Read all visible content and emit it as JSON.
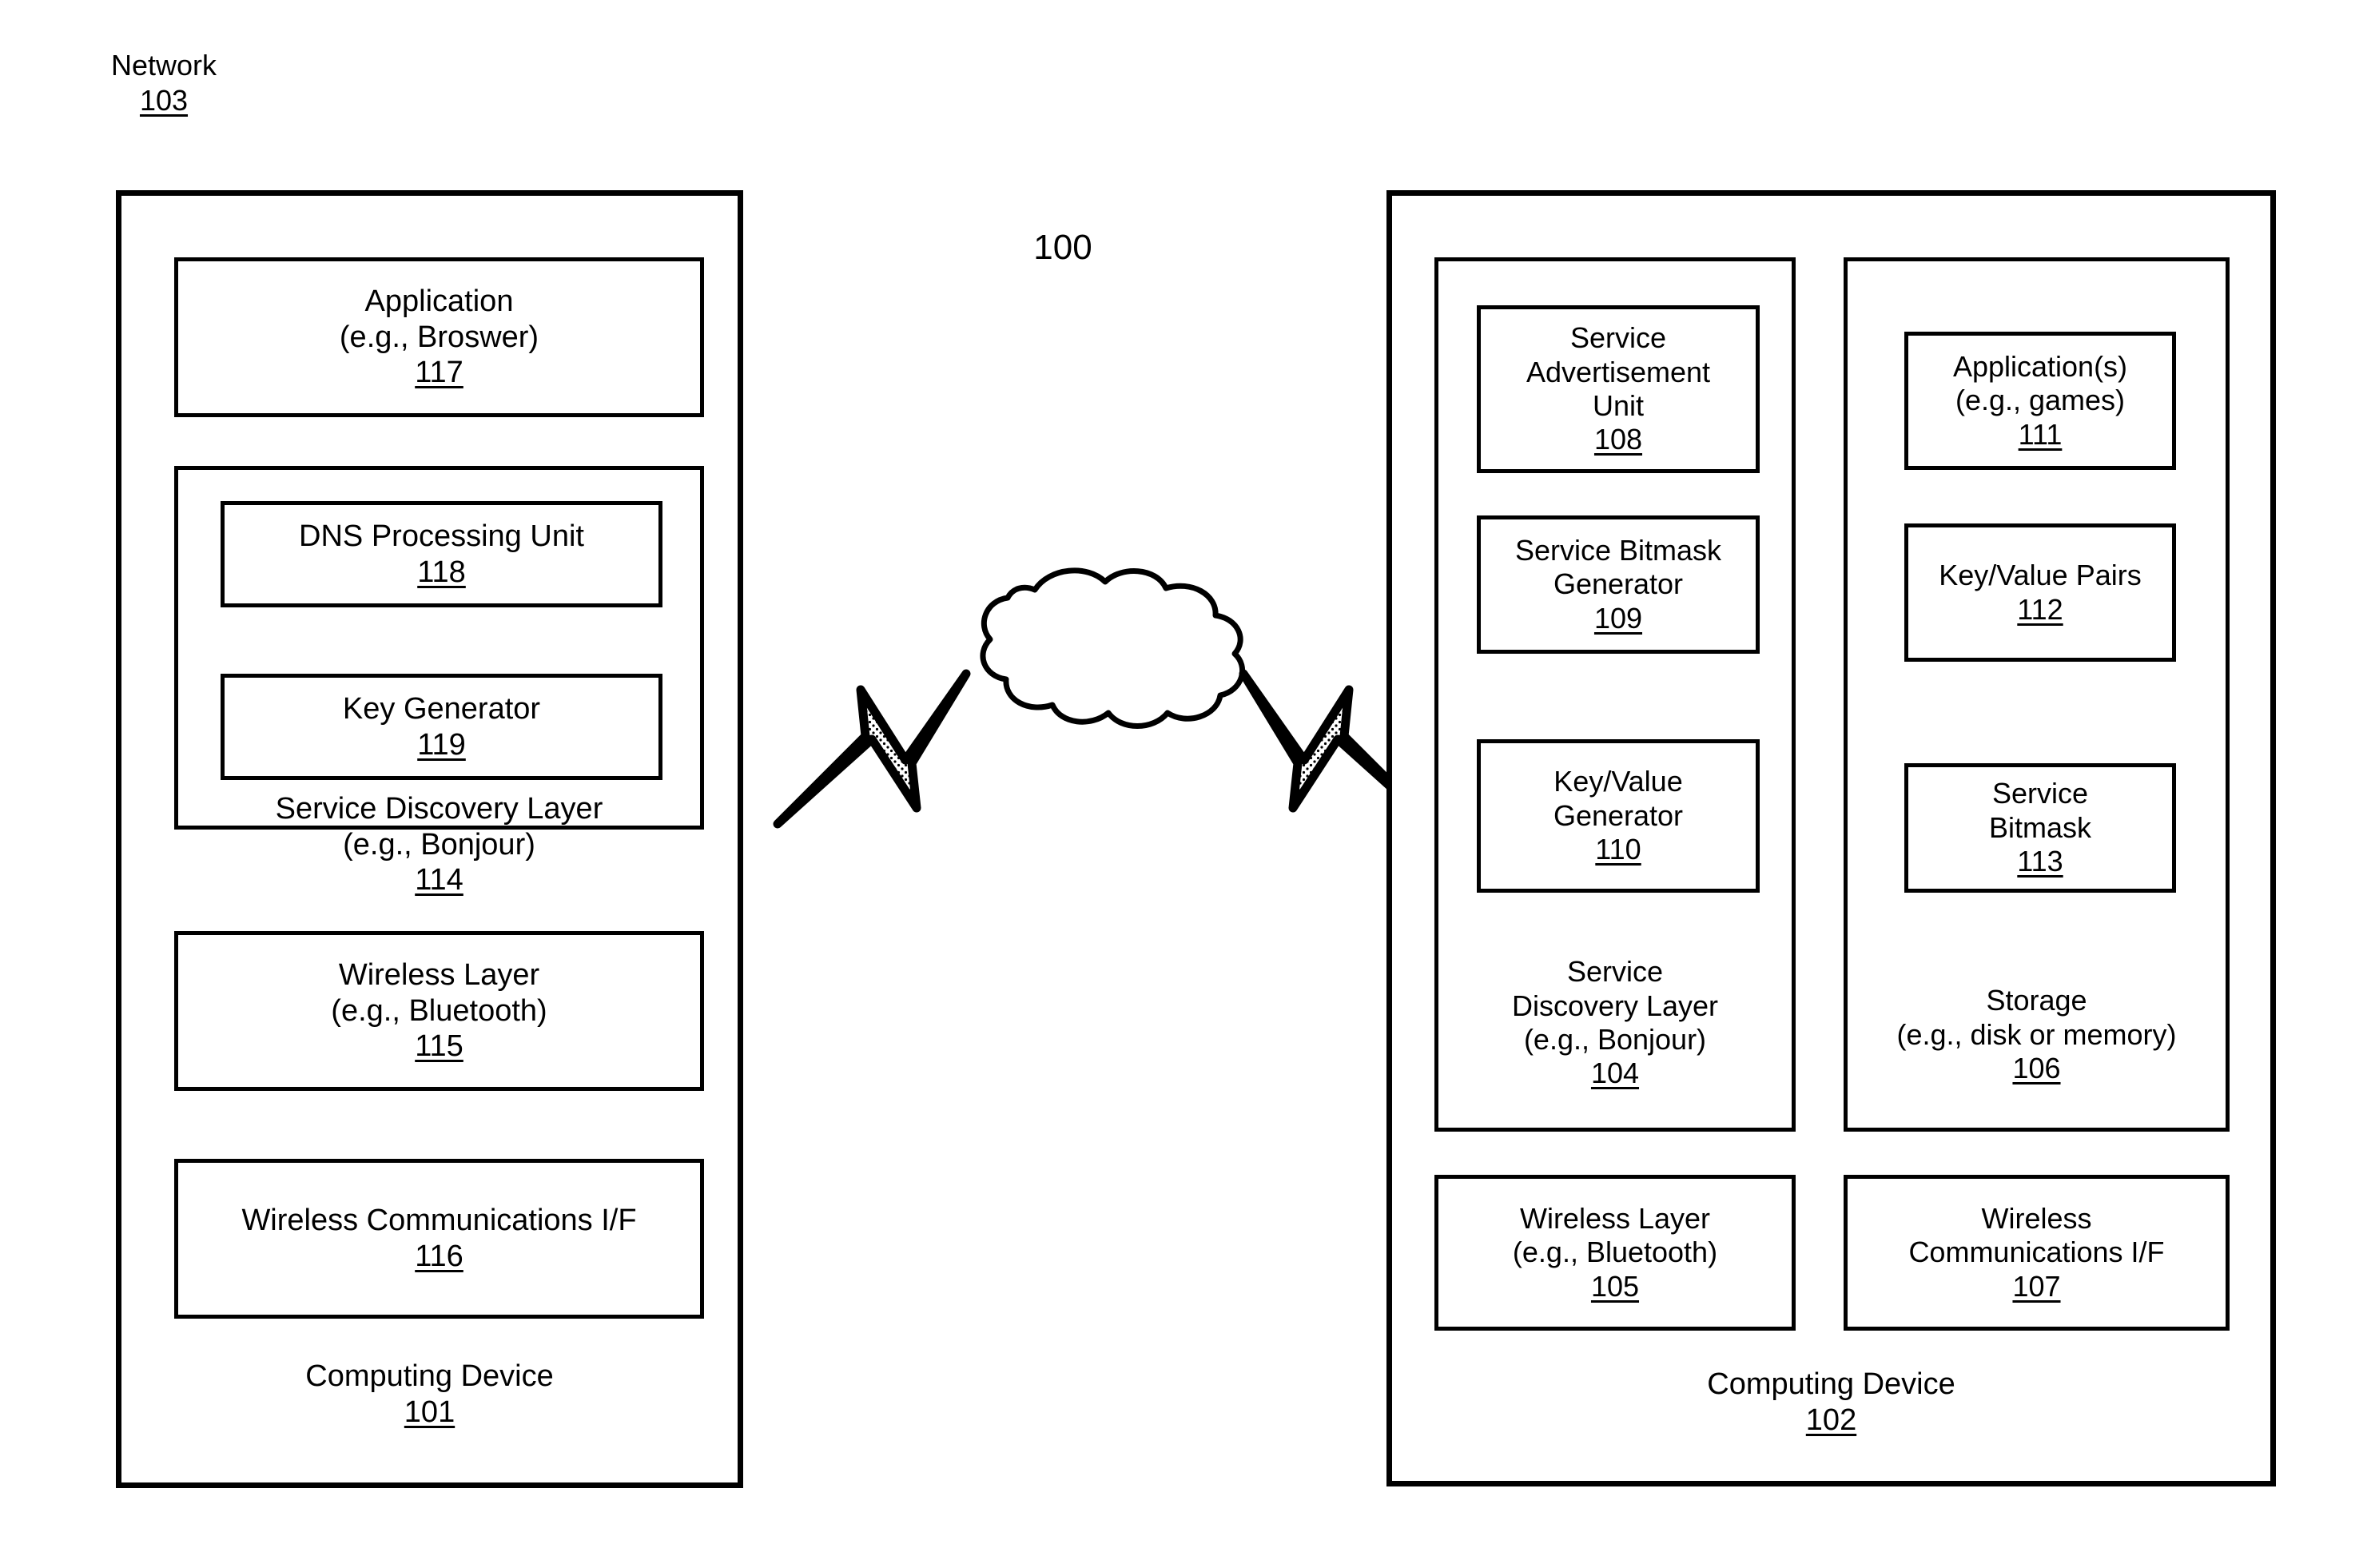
{
  "figure": {
    "number": "100"
  },
  "network": {
    "name": "Network",
    "ref": "103"
  },
  "left_device": {
    "title": "Computing Device",
    "ref": "101",
    "application": {
      "line1": "Application",
      "line2": "(e.g., Broswer)",
      "ref": "117"
    },
    "service_discovery_layer": {
      "line1": "Service Discovery Layer",
      "line2": "(e.g., Bonjour)",
      "ref": "114",
      "children": [
        {
          "line1": "DNS Processing Unit",
          "ref": "118"
        },
        {
          "line1": "Key Generator",
          "ref": "119"
        }
      ]
    },
    "wireless_layer": {
      "line1": "Wireless Layer",
      "line2": "(e.g., Bluetooth)",
      "ref": "115"
    },
    "wireless_comm_if": {
      "line1": "Wireless Communications I/F",
      "ref": "116"
    }
  },
  "right_device": {
    "title": "Computing Device",
    "ref": "102",
    "service_discovery_layer": {
      "line1": "Service",
      "line2": "Discovery Layer",
      "line3": "(e.g., Bonjour)",
      "ref": "104",
      "children": [
        {
          "line1": "Service",
          "line2": "Advertisement",
          "line3": "Unit",
          "ref": "108"
        },
        {
          "line1": "Service Bitmask",
          "line2": "Generator",
          "ref": "109"
        },
        {
          "line1": "Key/Value",
          "line2": "Generator",
          "ref": "110"
        }
      ]
    },
    "storage": {
      "line1": "Storage",
      "line2": "(e.g., disk or memory)",
      "ref": "106",
      "children": [
        {
          "line1": "Application(s)",
          "line2": "(e.g., games)",
          "ref": "111"
        },
        {
          "line1": "Key/Value Pairs",
          "ref": "112"
        },
        {
          "line1": "Service",
          "line2": "Bitmask",
          "ref": "113"
        }
      ]
    },
    "wireless_layer": {
      "line1": "Wireless Layer",
      "line2": "(e.g., Bluetooth)",
      "ref": "105"
    },
    "wireless_comm_if": {
      "line1": "Wireless",
      "line2": "Communications I/F",
      "ref": "107"
    }
  },
  "icons": {
    "cloud": "cloud-icon",
    "bolt_left": "lightning-bolt-icon",
    "bolt_right": "lightning-bolt-icon"
  },
  "colors": {
    "stroke": "#000000",
    "background": "#ffffff"
  }
}
